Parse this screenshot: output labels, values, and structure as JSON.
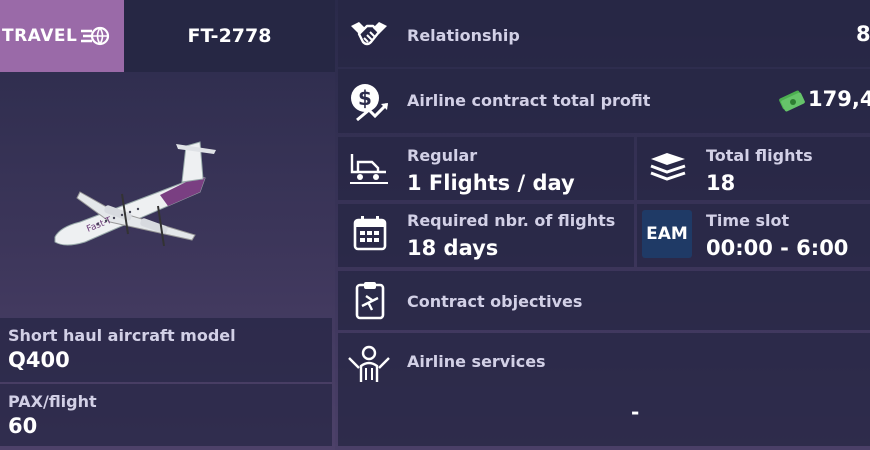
{
  "header": {
    "logo_text": "TRAVEL",
    "flight_code": "FT-2778"
  },
  "aircraft": {
    "model_label": "Short haul aircraft model",
    "model_value": "Q400",
    "pax_label": "PAX/flight",
    "pax_value": "60"
  },
  "relationship": {
    "label": "Relationship",
    "value": "8"
  },
  "profit": {
    "label": "Airline contract total profit",
    "value": "179,4"
  },
  "regular": {
    "label": "Regular",
    "value": "1 Flights / day"
  },
  "total_flights": {
    "label": "Total flights",
    "value": "18"
  },
  "required": {
    "label": "Required nbr. of flights",
    "value": "18 days"
  },
  "time_slot": {
    "badge": "EAM",
    "label": "Time slot",
    "value": "00:00 - 6:00"
  },
  "objectives": {
    "label": "Contract objectives"
  },
  "services": {
    "label": "Airline services",
    "value": "-"
  },
  "icons": [
    "handshake-icon",
    "dollar-chart-icon",
    "cash-icon",
    "plane-truck-icon",
    "stacked-planes-icon",
    "calendar-icon",
    "clipboard-plane-icon",
    "staff-icon"
  ]
}
